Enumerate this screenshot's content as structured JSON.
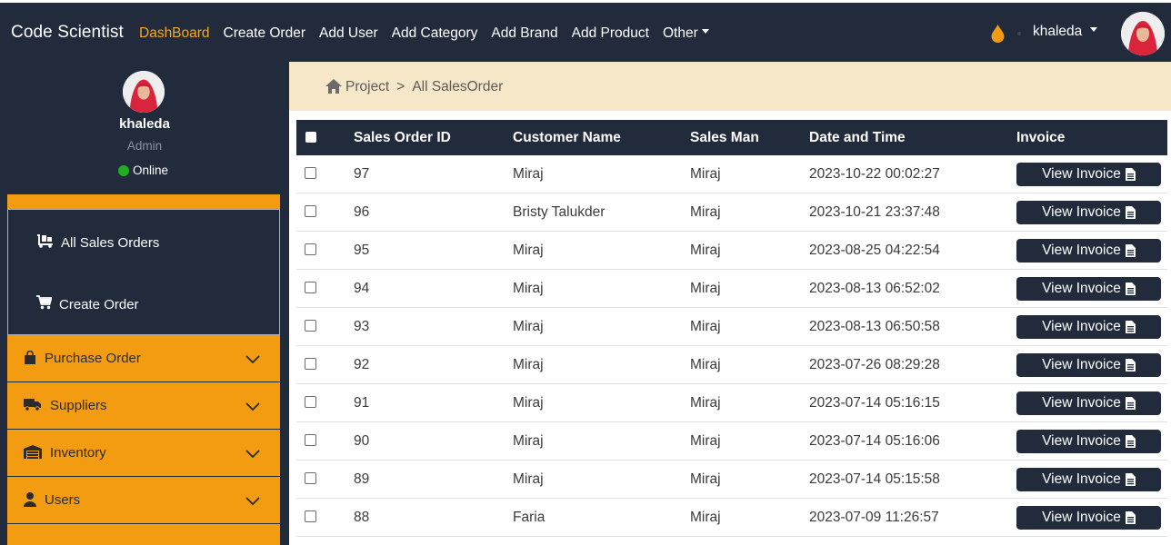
{
  "nav": {
    "brand": "Code Scientist",
    "links": [
      "DashBoard",
      "Create Order",
      "Add User",
      "Add Category",
      "Add Brand",
      "Add Product",
      "Other"
    ],
    "active_index": 0,
    "user": "khaleda",
    "accent": "#f5a623",
    "bg": "#212b3b"
  },
  "sidebar": {
    "name": "khaleda",
    "role": "Admin",
    "status": "Online",
    "submenu": [
      {
        "label": "All Sales Orders",
        "icon": "dolly-icon"
      },
      {
        "label": "Create Order",
        "icon": "cart-plus-icon"
      }
    ],
    "accordions": [
      {
        "label": "Purchase Order",
        "icon": "shopping-bag-icon"
      },
      {
        "label": "Suppliers",
        "icon": "truck-icon"
      },
      {
        "label": "Inventory",
        "icon": "warehouse-icon"
      },
      {
        "label": "Users",
        "icon": "user-icon"
      }
    ],
    "accent": "#f39c12"
  },
  "breadcrumb": {
    "root": "Project",
    "separator": ">",
    "current": "All SalesOrder"
  },
  "table": {
    "columns": [
      "Sales Order ID",
      "Customer Name",
      "Sales Man",
      "Date and Time",
      "Invoice"
    ],
    "button_label": "View Invoice",
    "rows": [
      {
        "id": "97",
        "customer": "Miraj",
        "salesman": "Miraj",
        "datetime": "2023-10-22 00:02:27"
      },
      {
        "id": "96",
        "customer": "Bristy Talukder",
        "salesman": "Miraj",
        "datetime": "2023-10-21 23:37:48"
      },
      {
        "id": "95",
        "customer": "Miraj",
        "salesman": "Miraj",
        "datetime": "2023-08-25 04:22:54"
      },
      {
        "id": "94",
        "customer": "Miraj",
        "salesman": "Miraj",
        "datetime": "2023-08-13 06:52:02"
      },
      {
        "id": "93",
        "customer": "Miraj",
        "salesman": "Miraj",
        "datetime": "2023-08-13 06:50:58"
      },
      {
        "id": "92",
        "customer": "Miraj",
        "salesman": "Miraj",
        "datetime": "2023-07-26 08:29:28"
      },
      {
        "id": "91",
        "customer": "Miraj",
        "salesman": "Miraj",
        "datetime": "2023-07-14 05:16:15"
      },
      {
        "id": "90",
        "customer": "Miraj",
        "salesman": "Miraj",
        "datetime": "2023-07-14 05:16:06"
      },
      {
        "id": "89",
        "customer": "Miraj",
        "salesman": "Miraj",
        "datetime": "2023-07-14 05:15:58"
      },
      {
        "id": "88",
        "customer": "Faria",
        "salesman": "Miraj",
        "datetime": "2023-07-09 11:26:57"
      }
    ]
  }
}
